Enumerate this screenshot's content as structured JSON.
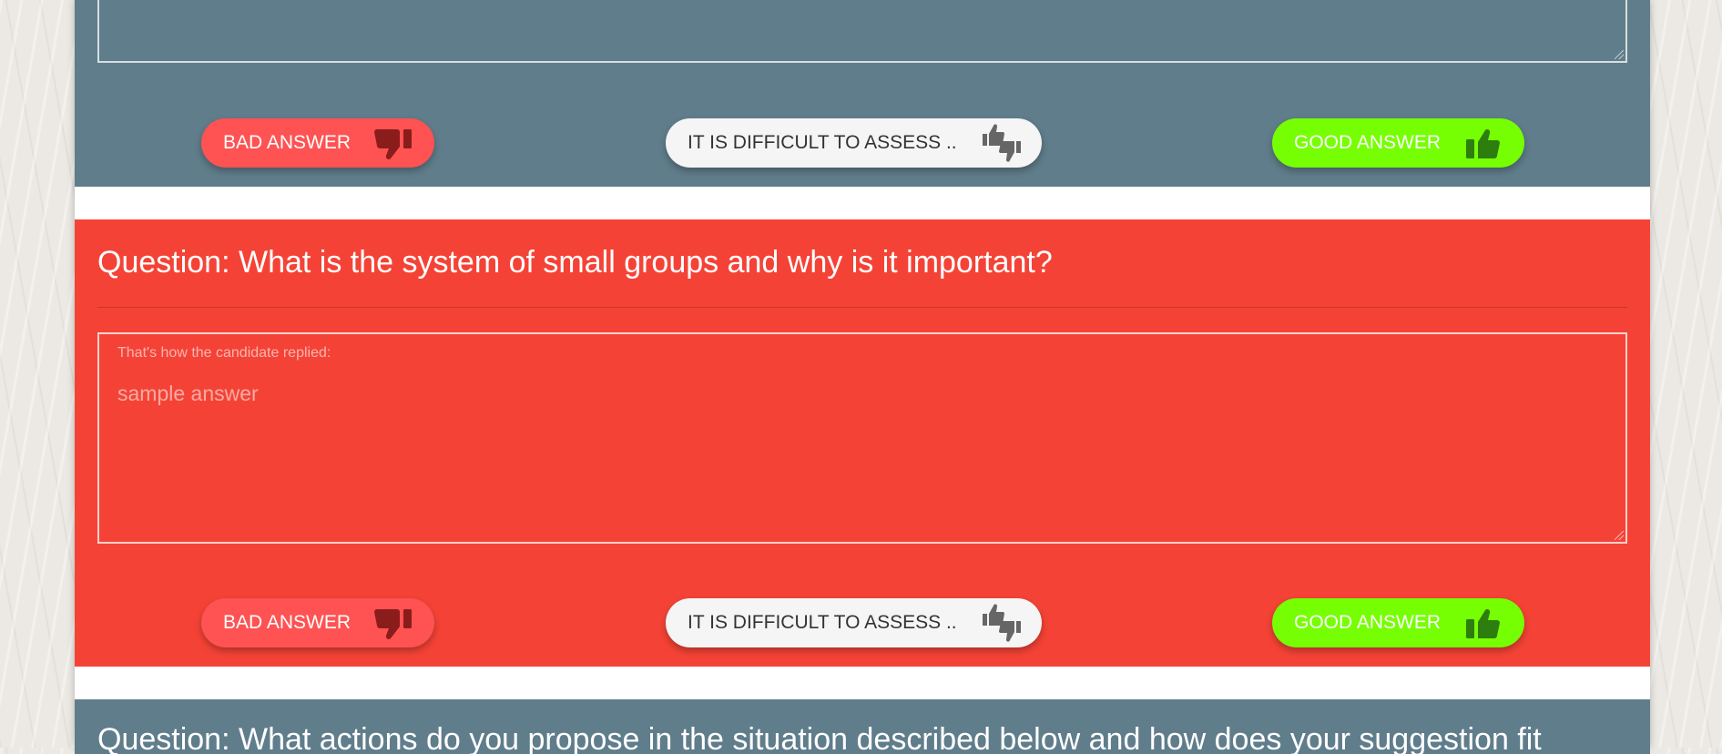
{
  "colors": {
    "gray_card": "#607d8b",
    "red_card": "#f44336",
    "bad_button": "#ff5252",
    "neutral_button": "#f5f5f5",
    "good_button": "#76ff03"
  },
  "buttons": {
    "bad": "BAD ANSWER",
    "difficult": "IT IS DIFFICULT TO ASSESS ..",
    "good": "GOOD ANSWER"
  },
  "icons": {
    "bad": "thumbs-down-icon",
    "difficult": "thumbs-up-down-icon",
    "good": "thumbs-up-icon"
  },
  "questions": [
    {
      "title": "",
      "label": "",
      "answer": ""
    },
    {
      "title": "Question: What is the system of small groups and why is it important?",
      "label": "That's how the candidate replied:",
      "answer": "sample answer"
    },
    {
      "title": "Question: What actions do you propose in the situation described below and how does your suggestion fit"
    }
  ]
}
